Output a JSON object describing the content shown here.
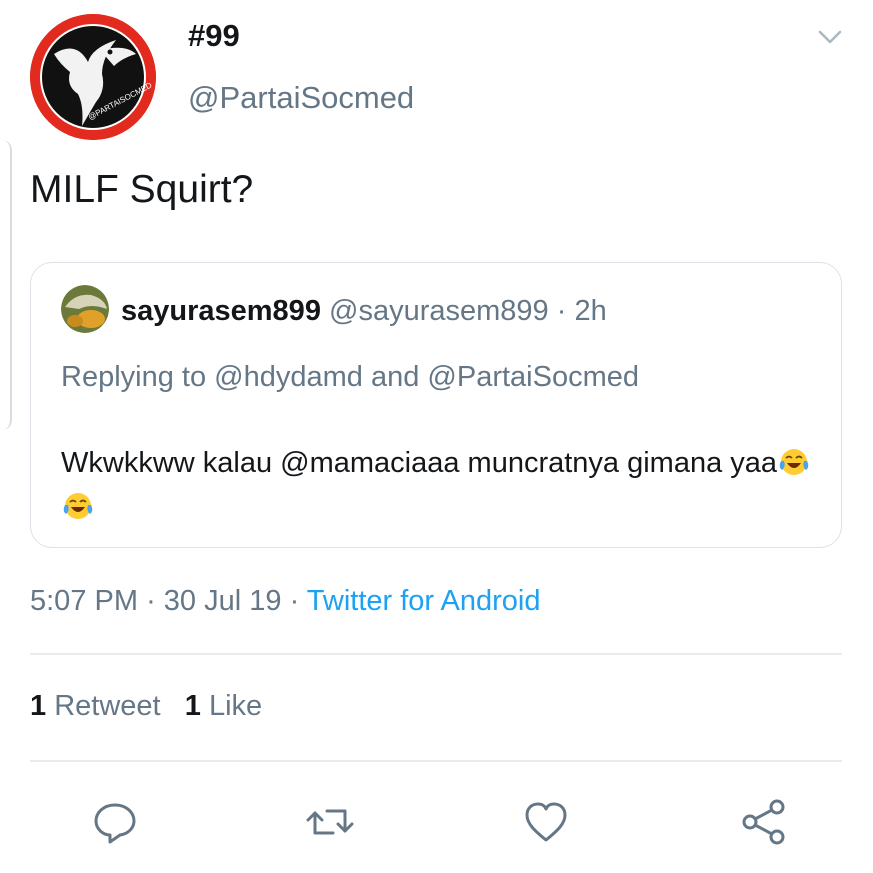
{
  "tweet": {
    "display_name": "#99",
    "handle": "@PartaiSocmed",
    "avatar_caption": "@PARTAISOCMED",
    "text": "MILF Squirt?",
    "timestamp": {
      "time": "5:07 PM",
      "sep1": "·",
      "date": "30 Jul 19",
      "sep2": "·",
      "source": "Twitter for Android"
    },
    "stats": {
      "retweets_count": "1",
      "retweets_label": "Retweet",
      "likes_count": "1",
      "likes_label": "Like"
    }
  },
  "quote": {
    "name": "sayurasem899",
    "handle": "@sayurasem899",
    "sep": "·",
    "time": "2h",
    "replying_prefix": "Replying to",
    "replying_user1": "@hdydamd",
    "replying_and": "and",
    "replying_user2": "@PartaiSocmed",
    "text": "Wkwkkww kalau @mamaciaaa muncratnya gimana yaa",
    "emojis": [
      "face-with-tears-of-joy",
      "face-with-tears-of-joy"
    ]
  },
  "actions": [
    "reply-icon",
    "retweet-icon",
    "like-icon",
    "share-icon"
  ],
  "colors": {
    "accent": "#1da1f2",
    "muted_text": "#657786",
    "primary_text": "#14171a",
    "avatar_red": "#e32a1f",
    "border": "#e6ecf0"
  }
}
